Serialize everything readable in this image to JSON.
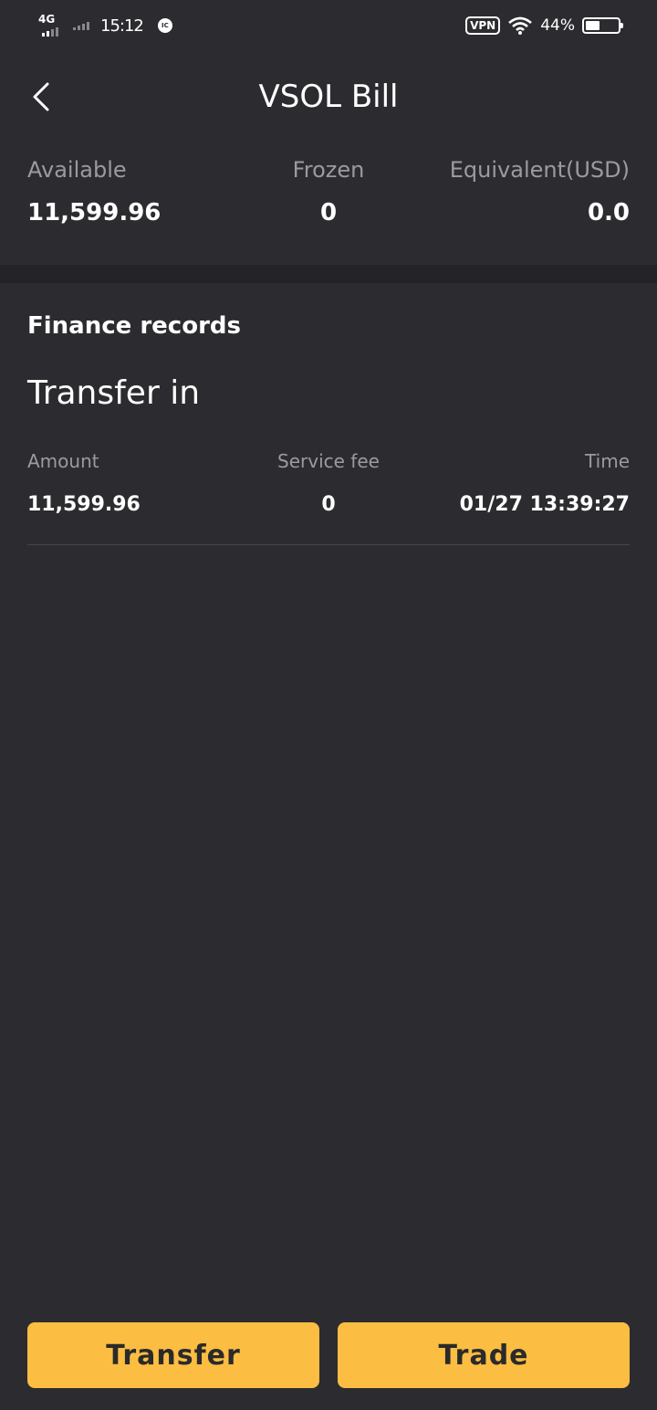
{
  "status_bar": {
    "network": "4G",
    "time": "15:12",
    "notification": "IC",
    "vpn": "VPN",
    "battery_text": "44%",
    "battery_level": 0.44
  },
  "header": {
    "title": "VSOL Bill"
  },
  "balance": {
    "available_label": "Available",
    "available_value": "11,599.96",
    "frozen_label": "Frozen",
    "frozen_value": "0",
    "equivalent_label": "Equivalent(USD)",
    "equivalent_value": "0.0"
  },
  "records": {
    "section_title": "Finance records",
    "items": [
      {
        "type": "Transfer in",
        "amount_label": "Amount",
        "amount": "11,599.96",
        "fee_label": "Service fee",
        "fee": "0",
        "time_label": "Time",
        "time": "01/27 13:39:27"
      }
    ]
  },
  "actions": {
    "transfer_label": "Transfer",
    "trade_label": "Trade"
  },
  "colors": {
    "background": "#2c2c30",
    "accent": "#fbbd42",
    "muted_text": "#9a9aa0"
  }
}
